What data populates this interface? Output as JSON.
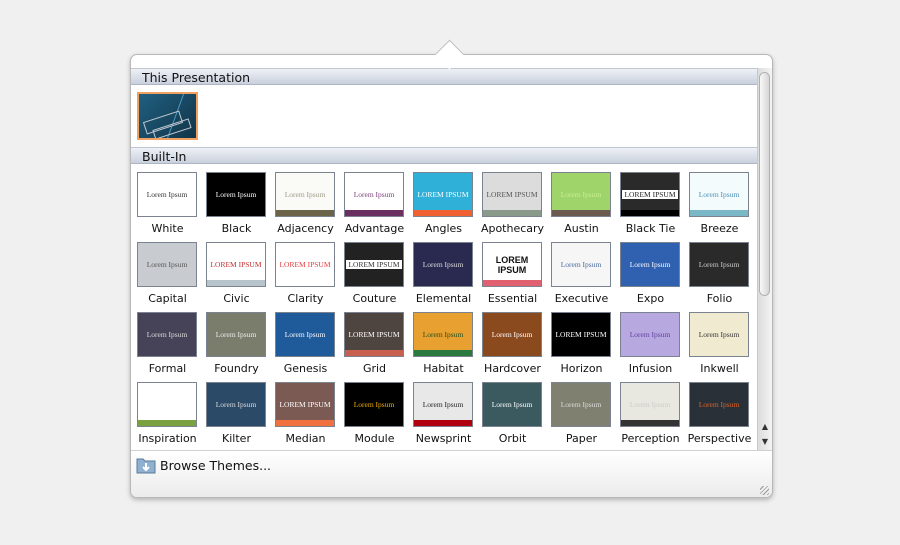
{
  "sections": {
    "this_presentation": "This Presentation",
    "built_in": "Built-In"
  },
  "current_theme": {
    "selected": true,
    "accent": "#f0a060"
  },
  "themes": [
    {
      "name": "White",
      "text": "Lorem Ipsum",
      "bg": "#ffffff",
      "fg": "#333333"
    },
    {
      "name": "Black",
      "text": "Lorem Ipsum",
      "bg": "#000000",
      "fg": "#ffffff"
    },
    {
      "name": "Adjacency",
      "text": "Lorem Ipsum",
      "bg": "#fafaf6",
      "fg": "#a09a88",
      "accent": "#6b6448"
    },
    {
      "name": "Advantage",
      "text": "Lorem Ipsum",
      "bg": "#ffffff",
      "fg": "#7a3f7a",
      "accent": "#6a3060"
    },
    {
      "name": "Angles",
      "text": "LOREM IPSUM",
      "bg": "#2eb0d8",
      "fg": "#ffffff",
      "accent": "#f06030"
    },
    {
      "name": "Apothecary",
      "text": "LOREM IPSUM",
      "bg": "#dcdcdc",
      "fg": "#555555",
      "accent": "#8a9a8a"
    },
    {
      "name": "Austin",
      "text": "Lorem Ipsum",
      "bg": "#9fd46a",
      "fg": "#c8f090",
      "accent": "#6a5a50"
    },
    {
      "name": "Black Tie",
      "text": "LOREM IPSUM",
      "bg": "#2a2a2a",
      "fg": "#222222",
      "accent": "#000000"
    },
    {
      "name": "Breeze",
      "text": "Lorem Ipsum",
      "bg": "#f4fbfc",
      "fg": "#4a90b8",
      "accent": "#7ab8c8"
    },
    {
      "name": "Capital",
      "text": "Lorem Ipsum",
      "bg": "#c8ccd0",
      "fg": "#555555"
    },
    {
      "name": "Civic",
      "text": "LOREM IPSUM",
      "bg": "#ffffff",
      "fg": "#c03030",
      "accent": "#b8c4cc"
    },
    {
      "name": "Clarity",
      "text": "LOREM IPSUM",
      "bg": "#ffffff",
      "fg": "#e04040"
    },
    {
      "name": "Couture",
      "text": "LOREM IPSUM",
      "bg": "#222222",
      "fg": "#333333"
    },
    {
      "name": "Elemental",
      "text": "Lorem Ipsum",
      "bg": "#2a2a50",
      "fg": "#dddddd"
    },
    {
      "name": "Essential",
      "text": "LOREM IPSUM",
      "bg": "#ffffff",
      "fg": "#111111",
      "accent": "#e06070"
    },
    {
      "name": "Executive",
      "text": "Lorem Ipsum",
      "bg": "#f6f6f6",
      "fg": "#4a6aa0"
    },
    {
      "name": "Expo",
      "text": "Lorem Ipsum",
      "bg": "#3060b0",
      "fg": "#ffffff"
    },
    {
      "name": "Folio",
      "text": "Lorem Ipsum",
      "bg": "#2a2a2a",
      "fg": "#cccccc"
    },
    {
      "name": "Formal",
      "text": "Lorem Ipsum",
      "bg": "#464258",
      "fg": "#dddddd"
    },
    {
      "name": "Foundry",
      "text": "Lorem Ipsum",
      "bg": "#7a7c6c",
      "fg": "#eeeeee"
    },
    {
      "name": "Genesis",
      "text": "Lorem Ipsum",
      "bg": "#1f5a9a",
      "fg": "#ffffff"
    },
    {
      "name": "Grid",
      "text": "LOREM IPSUM",
      "bg": "#4e4440",
      "fg": "#ffffff",
      "accent": "#c86050"
    },
    {
      "name": "Habitat",
      "text": "Lorem Ipsum",
      "bg": "#e8a030",
      "fg": "#205020",
      "accent": "#2a7a40"
    },
    {
      "name": "Hardcover",
      "text": "Lorem Ipsum",
      "bg": "#8a4a1e",
      "fg": "#ffffff"
    },
    {
      "name": "Horizon",
      "text": "LOREM IPSUM",
      "bg": "#000000",
      "fg": "#ffffff"
    },
    {
      "name": "Infusion",
      "text": "Lorem Ipsum",
      "bg": "#b8a8e0",
      "fg": "#6040a0"
    },
    {
      "name": "Inkwell",
      "text": "Lorem Ipsum",
      "bg": "#f0ead0",
      "fg": "#333333"
    },
    {
      "name": "Inspiration",
      "text": "Lorem Ipsum",
      "bg": "#ffffff",
      "fg": "#ffffff",
      "accent": "#7aa040"
    },
    {
      "name": "Kilter",
      "text": "Lorem Ipsum",
      "bg": "#2a4a68",
      "fg": "#dddddd"
    },
    {
      "name": "Median",
      "text": "LOREM IPSUM",
      "bg": "#7a5a52",
      "fg": "#ffffff",
      "accent": "#f07040"
    },
    {
      "name": "Module",
      "text": "Lorem Ipsum",
      "bg": "#000000",
      "fg": "#f0b000"
    },
    {
      "name": "Newsprint",
      "text": "Lorem Ipsum",
      "bg": "#e8e8e8",
      "fg": "#222222",
      "accent": "#b00010"
    },
    {
      "name": "Orbit",
      "text": "Lorem Ipsum",
      "bg": "#3a5a60",
      "fg": "#ffffff"
    },
    {
      "name": "Paper",
      "text": "Lorem Ipsum",
      "bg": "#808070",
      "fg": "#dddddd"
    },
    {
      "name": "Perception",
      "text": "Lorem Ipsum",
      "bg": "#e8e8e0",
      "fg": "#cccccc",
      "accent": "#333333"
    },
    {
      "name": "Perspective",
      "text": "Lorem Ipsum",
      "bg": "#2a3038",
      "fg": "#e06020"
    }
  ],
  "footer": {
    "browse_label": "Browse Themes...",
    "icon": "folder-icon"
  },
  "scrollbar": {
    "up": "▲",
    "down": "▼"
  }
}
